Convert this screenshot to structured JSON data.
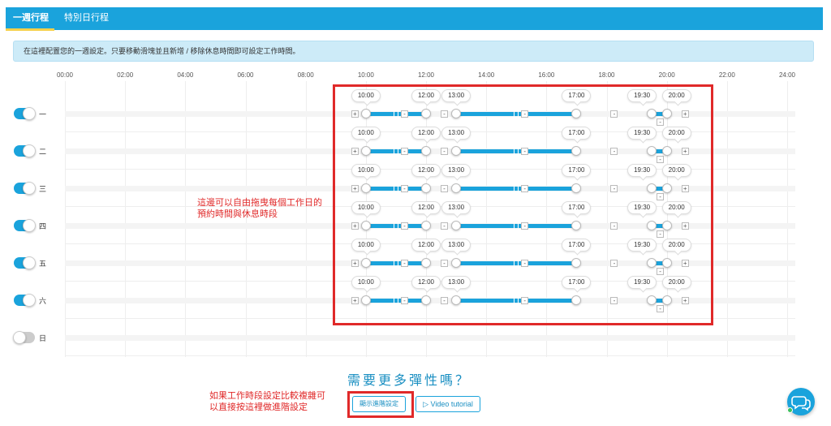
{
  "tabs": [
    {
      "label": "一週行程",
      "active": true
    },
    {
      "label": "特別日行程",
      "active": false
    }
  ],
  "banner_text": "在這裡配置您的一週設定。只要移動滑塊並且新增 / 移除休息時間即可設定工作時間。",
  "time_axis": [
    "00:00",
    "02:00",
    "04:00",
    "06:00",
    "08:00",
    "10:00",
    "12:00",
    "14:00",
    "16:00",
    "18:00",
    "20:00",
    "22:00",
    "24:00"
  ],
  "days": [
    {
      "label": "一",
      "enabled": true,
      "times": [
        "10:00",
        "12:00",
        "13:00",
        "17:00",
        "19:30",
        "20:00"
      ]
    },
    {
      "label": "二",
      "enabled": true,
      "times": [
        "10:00",
        "12:00",
        "13:00",
        "17:00",
        "19:30",
        "20:00"
      ]
    },
    {
      "label": "三",
      "enabled": true,
      "times": [
        "10:00",
        "12:00",
        "13:00",
        "17:00",
        "19:30",
        "20:00"
      ]
    },
    {
      "label": "四",
      "enabled": true,
      "times": [
        "10:00",
        "12:00",
        "13:00",
        "17:00",
        "19:30",
        "20:00"
      ]
    },
    {
      "label": "五",
      "enabled": true,
      "times": [
        "10:00",
        "12:00",
        "13:00",
        "17:00",
        "19:30",
        "20:00"
      ]
    },
    {
      "label": "六",
      "enabled": true,
      "times": [
        "10:00",
        "12:00",
        "13:00",
        "17:00",
        "19:30",
        "20:00"
      ]
    },
    {
      "label": "日",
      "enabled": false,
      "times": []
    }
  ],
  "annotation_drag": "這邊可以自由拖曳每個工作日的預約時間與休息時段",
  "annotation_adv": "如果工作時段設定比較複雜可以直接按這裡做進階設定",
  "more_flexibility_title": "需要更多彈性嗎？",
  "advanced_button_label": "顯示進階設定",
  "video_button_label": "▷ Video tutorial",
  "colors": {
    "accent": "#1aa3dc",
    "highlight": "#e02929",
    "toggle_off": "#cccccc"
  },
  "icons": {
    "chat": "chat-bubbles-icon",
    "add": "plus-icon",
    "remove": "minus-icon",
    "break": "pause-icon"
  }
}
